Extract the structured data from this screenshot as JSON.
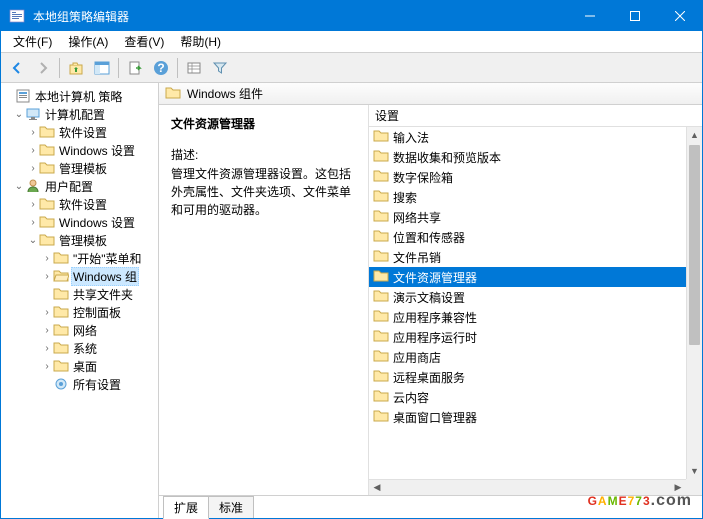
{
  "window": {
    "title": "本地组策略编辑器"
  },
  "menu": {
    "file": "文件(F)",
    "action": "操作(A)",
    "view": "查看(V)",
    "help": "帮助(H)"
  },
  "tree": {
    "root": "本地计算机 策略",
    "computer": "计算机配置",
    "c_software": "软件设置",
    "c_windows": "Windows 设置",
    "c_admin": "管理模板",
    "user": "用户配置",
    "u_software": "软件设置",
    "u_windows": "Windows 设置",
    "u_admin": "管理模板",
    "start": "\"开始\"菜单和",
    "wincomp": "Windows 组",
    "shared": "共享文件夹",
    "control": "控制面板",
    "network": "网络",
    "system": "系统",
    "desktop": "桌面",
    "all": "所有设置"
  },
  "header": {
    "title": "Windows 组件"
  },
  "desc": {
    "title": "文件资源管理器",
    "label": "描述:",
    "text": "管理文件资源管理器设置。这包括外壳属性、文件夹选项、文件菜单和可用的驱动器。"
  },
  "list": {
    "header": "设置",
    "items": [
      "输入法",
      "数据收集和预览版本",
      "数字保险箱",
      "搜索",
      "网络共享",
      "位置和传感器",
      "文件吊销",
      "文件资源管理器",
      "演示文稿设置",
      "应用程序兼容性",
      "应用程序运行时",
      "应用商店",
      "远程桌面服务",
      "云内容",
      "桌面窗口管理器"
    ],
    "selectedIndex": 7
  },
  "tabs": {
    "extended": "扩展",
    "standard": "标准"
  },
  "watermark": "GAME773.com"
}
